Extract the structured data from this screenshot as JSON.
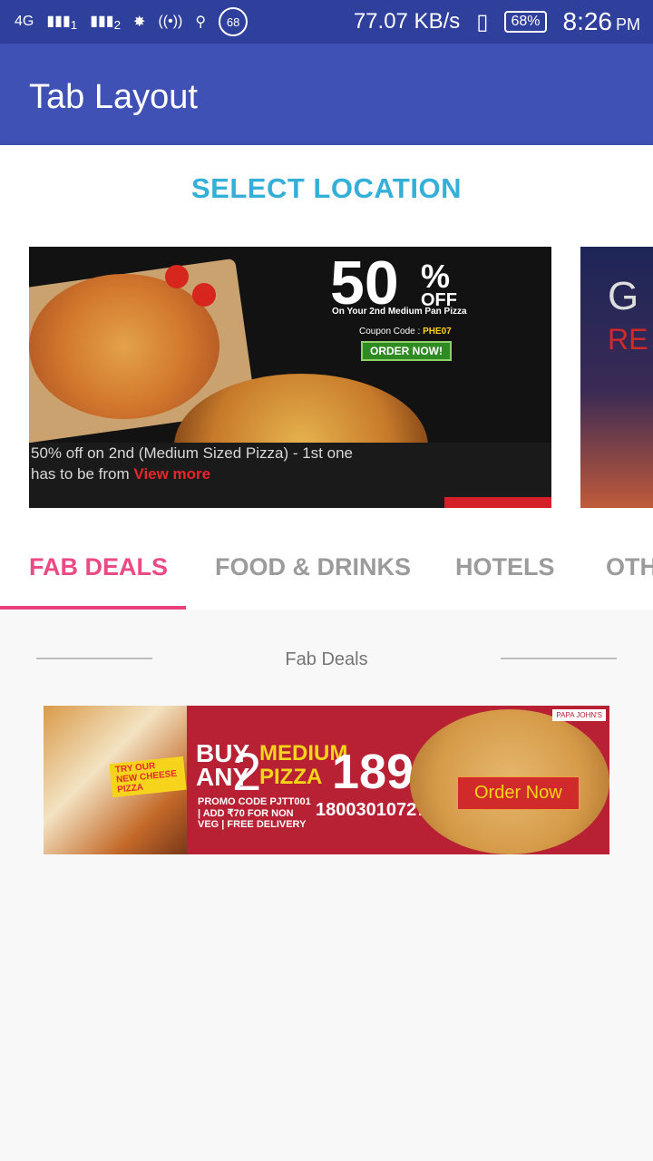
{
  "status_bar": {
    "network": "4G",
    "sim1": "1",
    "sim2": "2",
    "notification_count": "68",
    "speed": "77.07 KB/s",
    "battery": "68%",
    "time": "8:26",
    "ampm": "PM"
  },
  "app_bar": {
    "title": "Tab Layout"
  },
  "location": {
    "label": "SELECT LOCATION"
  },
  "carousel": {
    "cards": [
      {
        "promo_big": "50",
        "promo_percent": "%",
        "promo_off": "OFF",
        "promo_subtitle": "On Your 2nd Medium Pan Pizza",
        "coupon_label": "Coupon Code :",
        "coupon_code": "PHE07",
        "order_now": "ORDER NOW!",
        "caption_line1": "50% off on 2nd (Medium Sized Pizza) - 1st one",
        "caption_line2": "has to be from",
        "view_more": "View more"
      },
      {
        "text1": "G",
        "text2": "RE"
      }
    ]
  },
  "tabs": {
    "items": [
      {
        "label": "FAB DEALS",
        "active": true
      },
      {
        "label": "FOOD & DRINKS",
        "active": false
      },
      {
        "label": "HOTELS",
        "active": false
      },
      {
        "label": "OTH",
        "active": false
      }
    ]
  },
  "section": {
    "title": "Fab Deals",
    "banner": {
      "try_our": "TRY OUR NEW CHEESE PIZZA",
      "buy": "BUY ANY",
      "two": "2",
      "medium": "MEDIUM PIZZA",
      "price": "189",
      "promo": "PROMO CODE PJTT001 | ADD ₹70 FOR NON VEG | FREE DELIVERY",
      "phone": "180030107272",
      "order_now": "Order Now",
      "logo": "PAPA JOHN'S"
    }
  },
  "colors": {
    "status_bar": "#2f3f9c",
    "app_bar": "#3f51b5",
    "accent_location": "#34b0d8",
    "tab_active": "#ec4a85",
    "tab_inactive": "#9b9b9b"
  }
}
